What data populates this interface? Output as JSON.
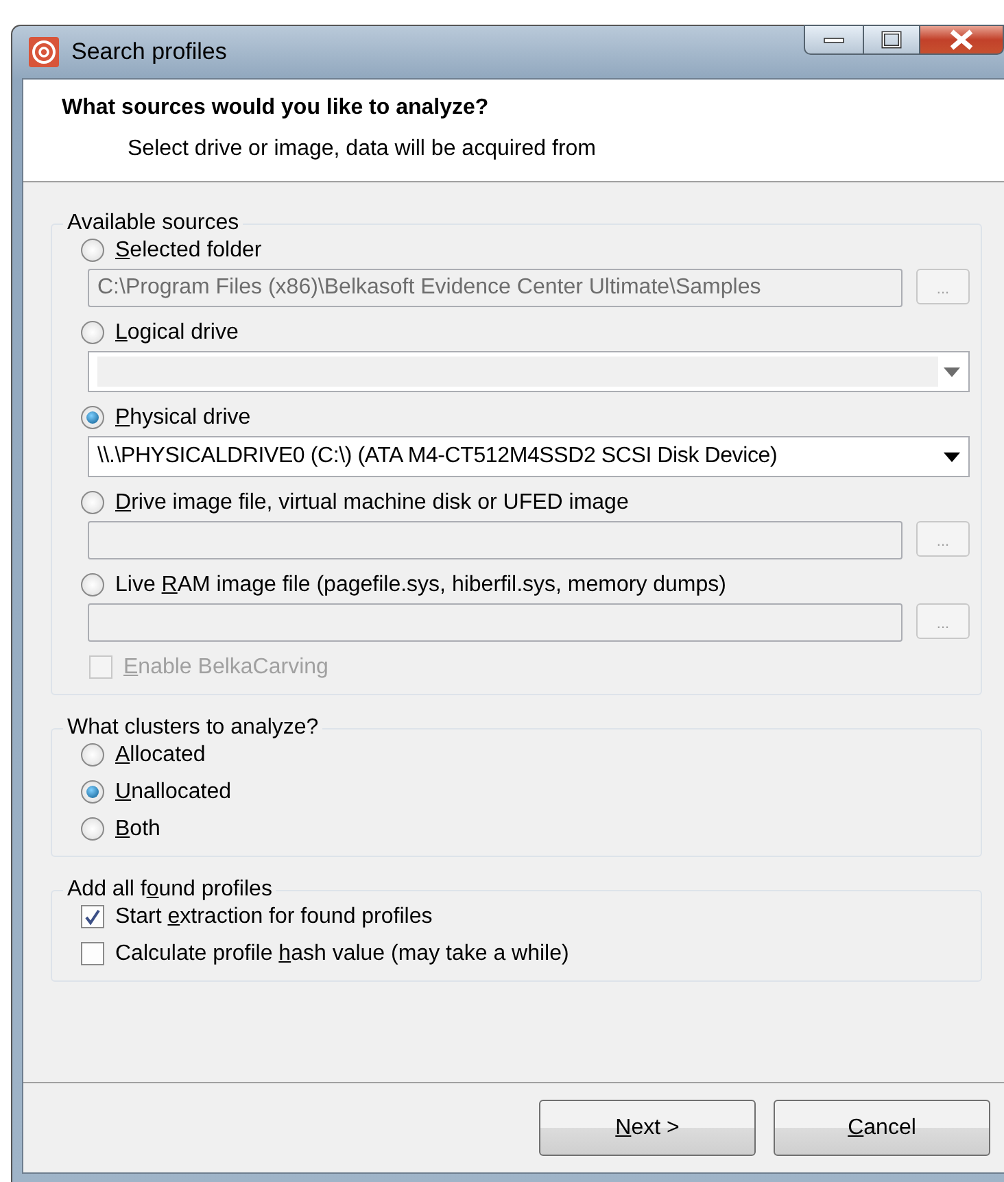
{
  "window": {
    "title": "Search profiles"
  },
  "header": {
    "heading": "What sources would you like to analyze?",
    "subtitle": "Select drive or image, data will be acquired from"
  },
  "sources": {
    "legend": {
      "text": "Available sources"
    },
    "items": [
      {
        "label": {
          "key": "S",
          "after": "elected folder"
        },
        "selected": false,
        "field": {
          "kind": "path",
          "value": "C:\\Program Files (x86)\\Belkasoft Evidence Center Ultimate\\Samples",
          "disabled": true,
          "browse": "..."
        }
      },
      {
        "label": {
          "key": "L",
          "after": "ogical drive"
        },
        "selected": false,
        "field": {
          "kind": "combo",
          "disabled": true
        }
      },
      {
        "label": {
          "key": "P",
          "after": "hysical drive"
        },
        "selected": true,
        "field": {
          "kind": "combo",
          "value": "\\\\.\\PHYSICALDRIVE0 (C:\\) (ATA M4-CT512M4SSD2 SCSI Disk Device)",
          "disabled": false
        }
      },
      {
        "label": {
          "key": "D",
          "after": "rive image file, virtual machine disk or UFED image"
        },
        "selected": false,
        "field": {
          "kind": "path",
          "disabled": true,
          "browse": "..."
        }
      },
      {
        "label": {
          "before": "Live ",
          "key": "R",
          "after": "AM image file (pagefile.sys, hiberfil.sys, memory dumps)"
        },
        "selected": false,
        "field": {
          "kind": "path",
          "disabled": true,
          "browse": "..."
        }
      }
    ],
    "carving": {
      "label": {
        "key": "E",
        "after": "nable BelkaCarving"
      },
      "checked": false,
      "disabled": true
    }
  },
  "clusters": {
    "legend": {
      "text": "What clusters to analyze?"
    },
    "items": [
      {
        "label": {
          "key": "A",
          "after": "llocated"
        },
        "selected": false
      },
      {
        "label": {
          "key": "U",
          "after": "nallocated"
        },
        "selected": true
      },
      {
        "label": {
          "key": "B",
          "after": "oth"
        },
        "selected": false
      }
    ]
  },
  "profiles": {
    "legend": {
      "before": "Add all f",
      "key": "o",
      "after": "und profiles"
    },
    "items": [
      {
        "label": {
          "before": "Start ",
          "key": "e",
          "after": "xtraction for found profiles"
        },
        "checked": true
      },
      {
        "label": {
          "before": "Calculate profile ",
          "key": "h",
          "after": "ash value (may take a while)"
        },
        "checked": false
      }
    ]
  },
  "buttons": [
    {
      "label": {
        "key": "N",
        "after": "ext >"
      }
    },
    {
      "label": {
        "key": "C",
        "after": "ancel"
      }
    }
  ]
}
